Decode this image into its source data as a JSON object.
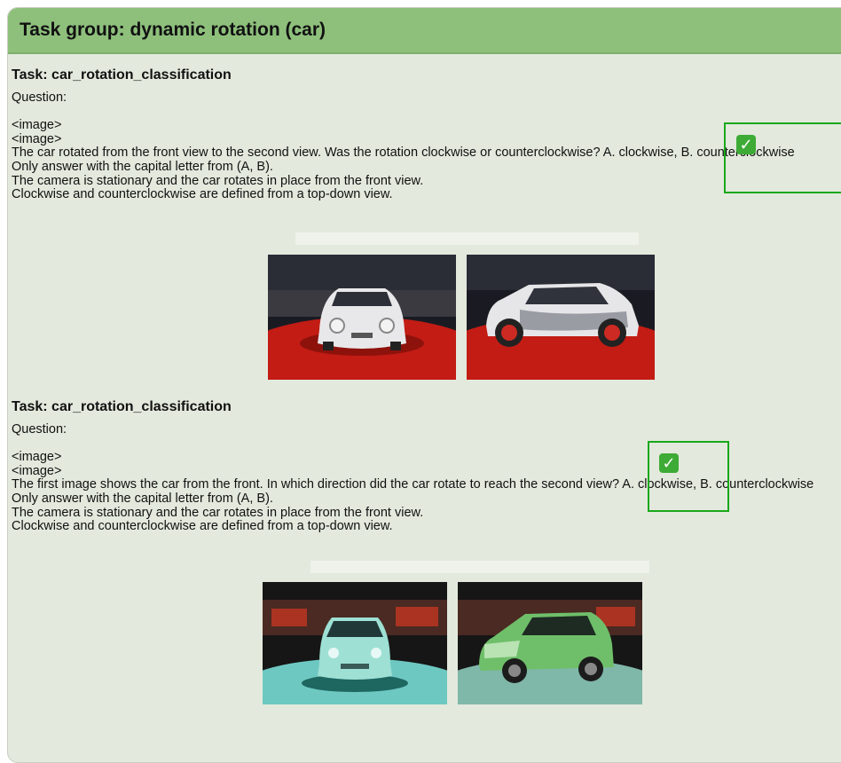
{
  "header": {
    "title": "Task group:  dynamic rotation (car)"
  },
  "tasks": [
    {
      "title": "Task: car_rotation_classification",
      "question_label": "Question:",
      "lines": [
        "<image>",
        "<image>",
        "The car rotated from the front view to the second view. Was the rotation clockwise or counterclockwise? A. clockwise, B. counterclockwise",
        "Only answer with the capital letter from (A, B).",
        "The camera is stationary and the car rotates in place from the front view.",
        "Clockwise and counterclockwise are defined from a top-down view."
      ],
      "images": [
        "white-red car front view",
        "white-red car side view"
      ],
      "marked_answer": "B. counterclockwise"
    },
    {
      "title": "Task: car_rotation_classification",
      "question_label": "Question:",
      "lines": [
        "<image>",
        "<image>",
        "The first image shows the car from the front. In which direction did the car rotate to reach the second view? A. clockwise, B. counterclockwise",
        "Only answer with the capital letter from (A, B).",
        "The camera is stationary and the car rotates in place from the front view.",
        "Clockwise and counterclockwise are defined from a top-down view."
      ],
      "images": [
        "green car front view",
        "green car three-quarter view"
      ],
      "marked_answer": "A. clockwise"
    }
  ],
  "icons": {
    "check": "check-mark-icon"
  },
  "colors": {
    "header_bg": "#8ec07c",
    "card_bg": "#e3e9dd",
    "highlight": "#19a81a"
  }
}
